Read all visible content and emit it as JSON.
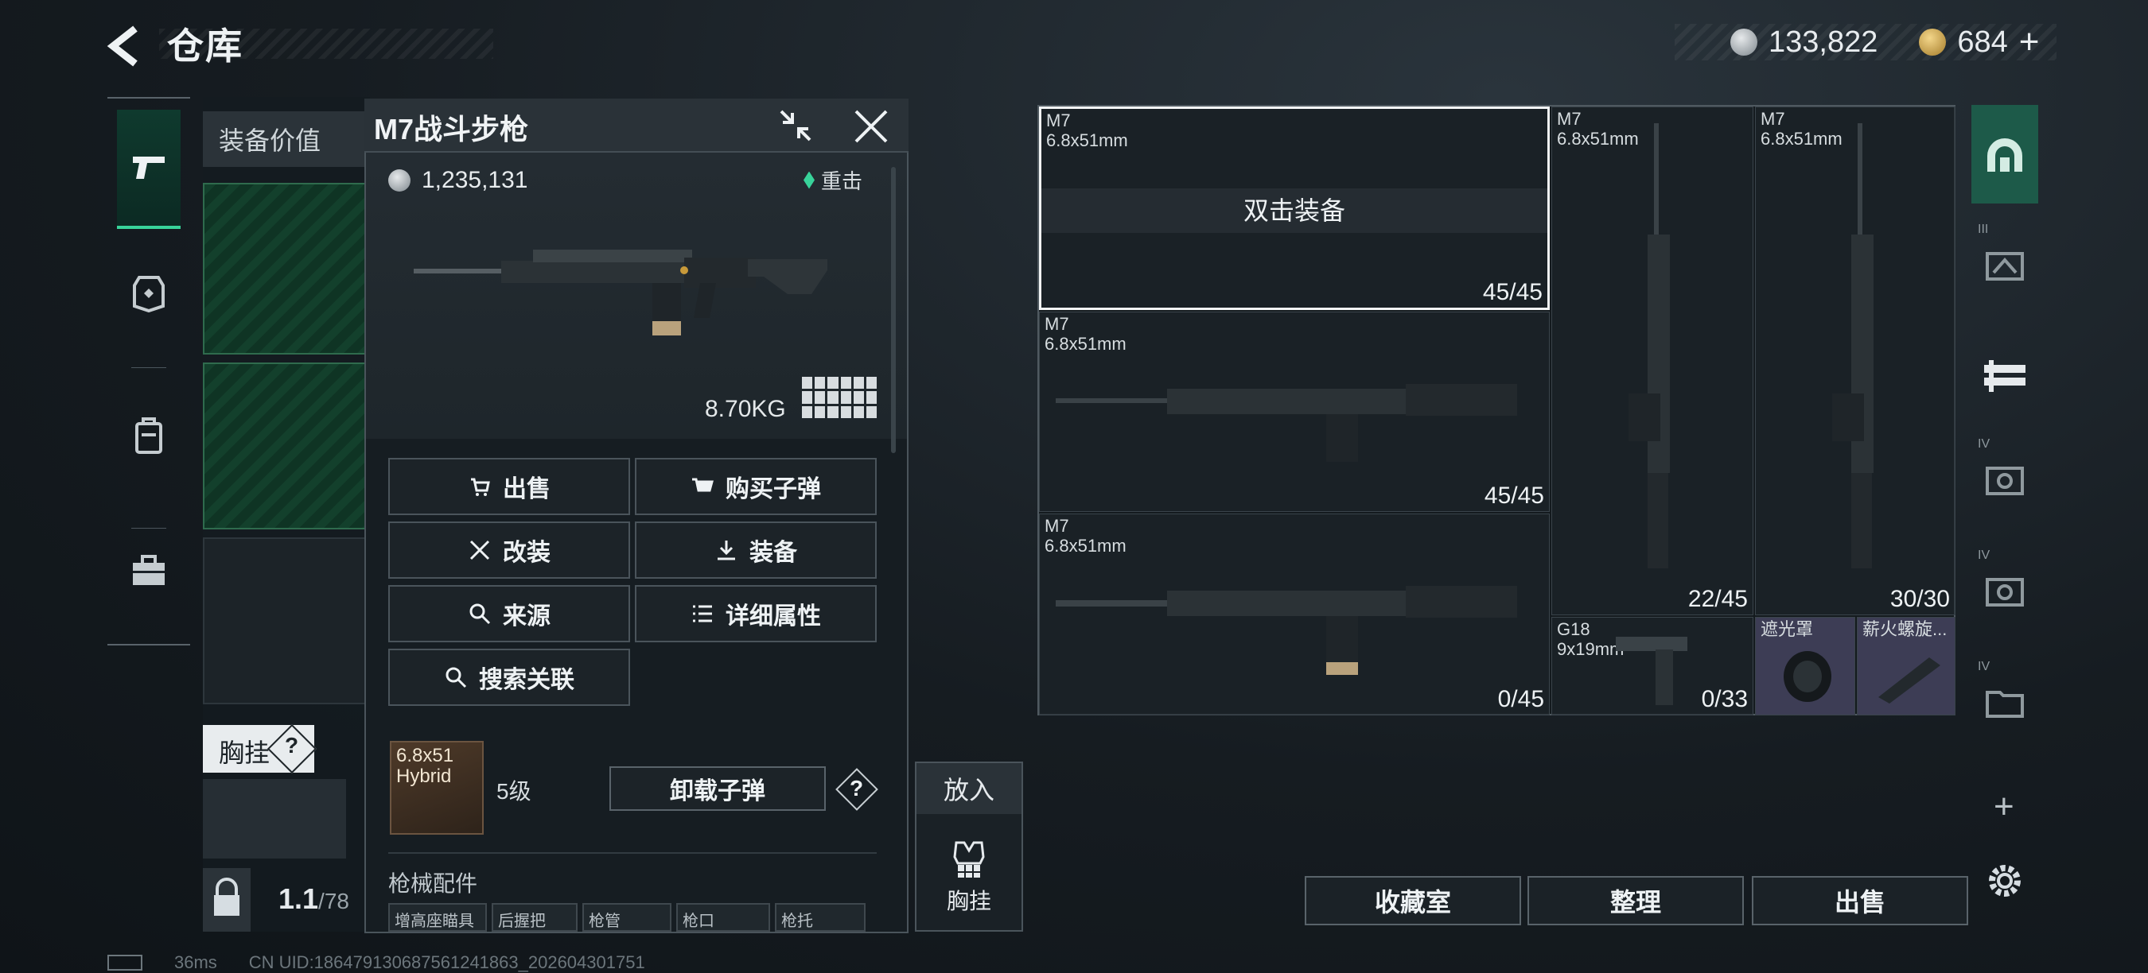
{
  "header": {
    "title": "仓库",
    "silver": "133,822",
    "gold": "684"
  },
  "left_panel": {
    "value_label": "装备价值",
    "chest_label": "胸挂",
    "chest_help": "?",
    "weight_value": "1.1",
    "weight_max": "/78"
  },
  "detail": {
    "name": "M7战斗步枪",
    "price": "1,235,131",
    "tag": "重击",
    "weight": "8.70KG",
    "actions": {
      "sell": "出售",
      "buy_ammo": "购买子弹",
      "modify": "改装",
      "equip": "装备",
      "source": "来源",
      "details": "详细属性",
      "search_related": "搜索关联"
    },
    "ammo": {
      "caliber": "6.8x51",
      "type": "Hybrid",
      "level": "5级",
      "unload": "卸载子弹",
      "help": "?"
    },
    "attachments_label": "枪械配件",
    "attachments": [
      "增高座瞄具",
      "后握把",
      "枪管",
      "枪口",
      "枪托"
    ]
  },
  "put_in": {
    "label": "放入",
    "target": "胸挂"
  },
  "inventory": {
    "hint": "双击装备",
    "items": [
      {
        "name": "M7",
        "caliber": "6.8x51mm",
        "ammo": "45/45"
      },
      {
        "name": "M7",
        "caliber": "6.8x51mm",
        "ammo": "22/45"
      },
      {
        "name": "M7",
        "caliber": "6.8x51mm",
        "ammo": "30/30"
      },
      {
        "name": "M7",
        "caliber": "6.8x51mm",
        "ammo": "45/45"
      },
      {
        "name": "M7",
        "caliber": "6.8x51mm",
        "ammo": "0/45"
      },
      {
        "name": "G18",
        "caliber": "9x19mm",
        "ammo": "0/33"
      },
      {
        "name": "遮光罩",
        "caliber": "",
        "ammo": ""
      },
      {
        "name": "薪火螺旋...",
        "caliber": "",
        "ammo": ""
      }
    ]
  },
  "right_rail": {
    "labels": [
      "III",
      "IV",
      "IV",
      "IV"
    ],
    "add": "+"
  },
  "bottom_buttons": {
    "collection": "收藏室",
    "sort": "整理",
    "sell": "出售"
  },
  "status_bar": {
    "ping": "36ms",
    "uid": "CN UID:1864791306875612418​63_202604301751"
  },
  "icons": [
    "back-arrow-icon",
    "silver-coin-icon",
    "gold-coin-icon",
    "pistol-icon",
    "armor-icon",
    "backpack-icon",
    "briefcase-icon",
    "collapse-icon",
    "close-icon",
    "lock-icon",
    "gear-icon"
  ]
}
